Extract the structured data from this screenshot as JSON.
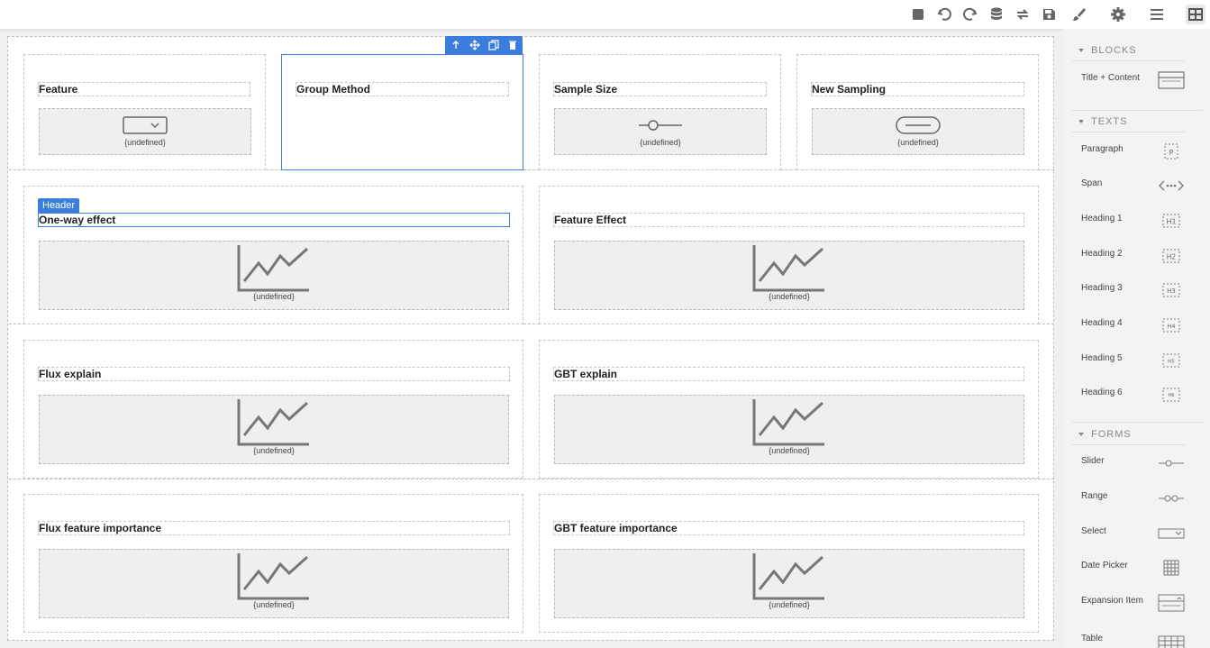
{
  "toolbar": {
    "icons": [
      "square-icon",
      "undo-icon",
      "redo-icon",
      "database-icon",
      "sync-icon",
      "save-icon"
    ]
  },
  "right_tabs": [
    "brush-icon",
    "gear-icon",
    "menu-icon",
    "grid-icon"
  ],
  "canvas": {
    "row1": {
      "c1": {
        "title": "Feature",
        "placeholder": "{undefined}"
      },
      "c2": {
        "title": "Group Method"
      },
      "c3": {
        "title": "Sample Size",
        "placeholder": "{undefined}"
      },
      "c4": {
        "title": "New Sampling",
        "placeholder": "{undefined}"
      }
    },
    "row2": {
      "c1": {
        "title": "One-way effect",
        "placeholder": "{undefined}"
      },
      "c2": {
        "title": "Feature Effect",
        "placeholder": "{undefined}"
      }
    },
    "row3": {
      "c1": {
        "title": "Flux explain",
        "placeholder": "{undefined}"
      },
      "c2": {
        "title": "GBT explain",
        "placeholder": "{undefined}"
      }
    },
    "row4": {
      "c1": {
        "title": "Flux feature importance",
        "placeholder": "{undefined}"
      },
      "c2": {
        "title": "GBT feature importance",
        "placeholder": "{undefined}"
      }
    },
    "header_badge": "Header"
  },
  "panel": {
    "blocks_head": "BLOCKS",
    "blocks": [
      {
        "label": "Title + Content"
      }
    ],
    "texts_head": "TEXTS",
    "texts": [
      {
        "label": "Paragraph",
        "badge": "P"
      },
      {
        "label": "Span"
      },
      {
        "label": "Heading 1",
        "badge": "H1"
      },
      {
        "label": "Heading 2",
        "badge": "H2"
      },
      {
        "label": "Heading 3",
        "badge": "H3"
      },
      {
        "label": "Heading 4",
        "badge": "H4"
      },
      {
        "label": "Heading 5",
        "badge": "H5"
      },
      {
        "label": "Heading 6",
        "badge": "H6"
      }
    ],
    "forms_head": "FORMS",
    "forms": [
      {
        "label": "Slider"
      },
      {
        "label": "Range"
      },
      {
        "label": "Select"
      },
      {
        "label": "Date Picker"
      },
      {
        "label": "Expansion Item"
      },
      {
        "label": "Table"
      }
    ]
  },
  "colors": {
    "accent": "#3b7ddd",
    "panel_bg": "#f3f3f3",
    "placeholder_bg": "#efefef"
  }
}
